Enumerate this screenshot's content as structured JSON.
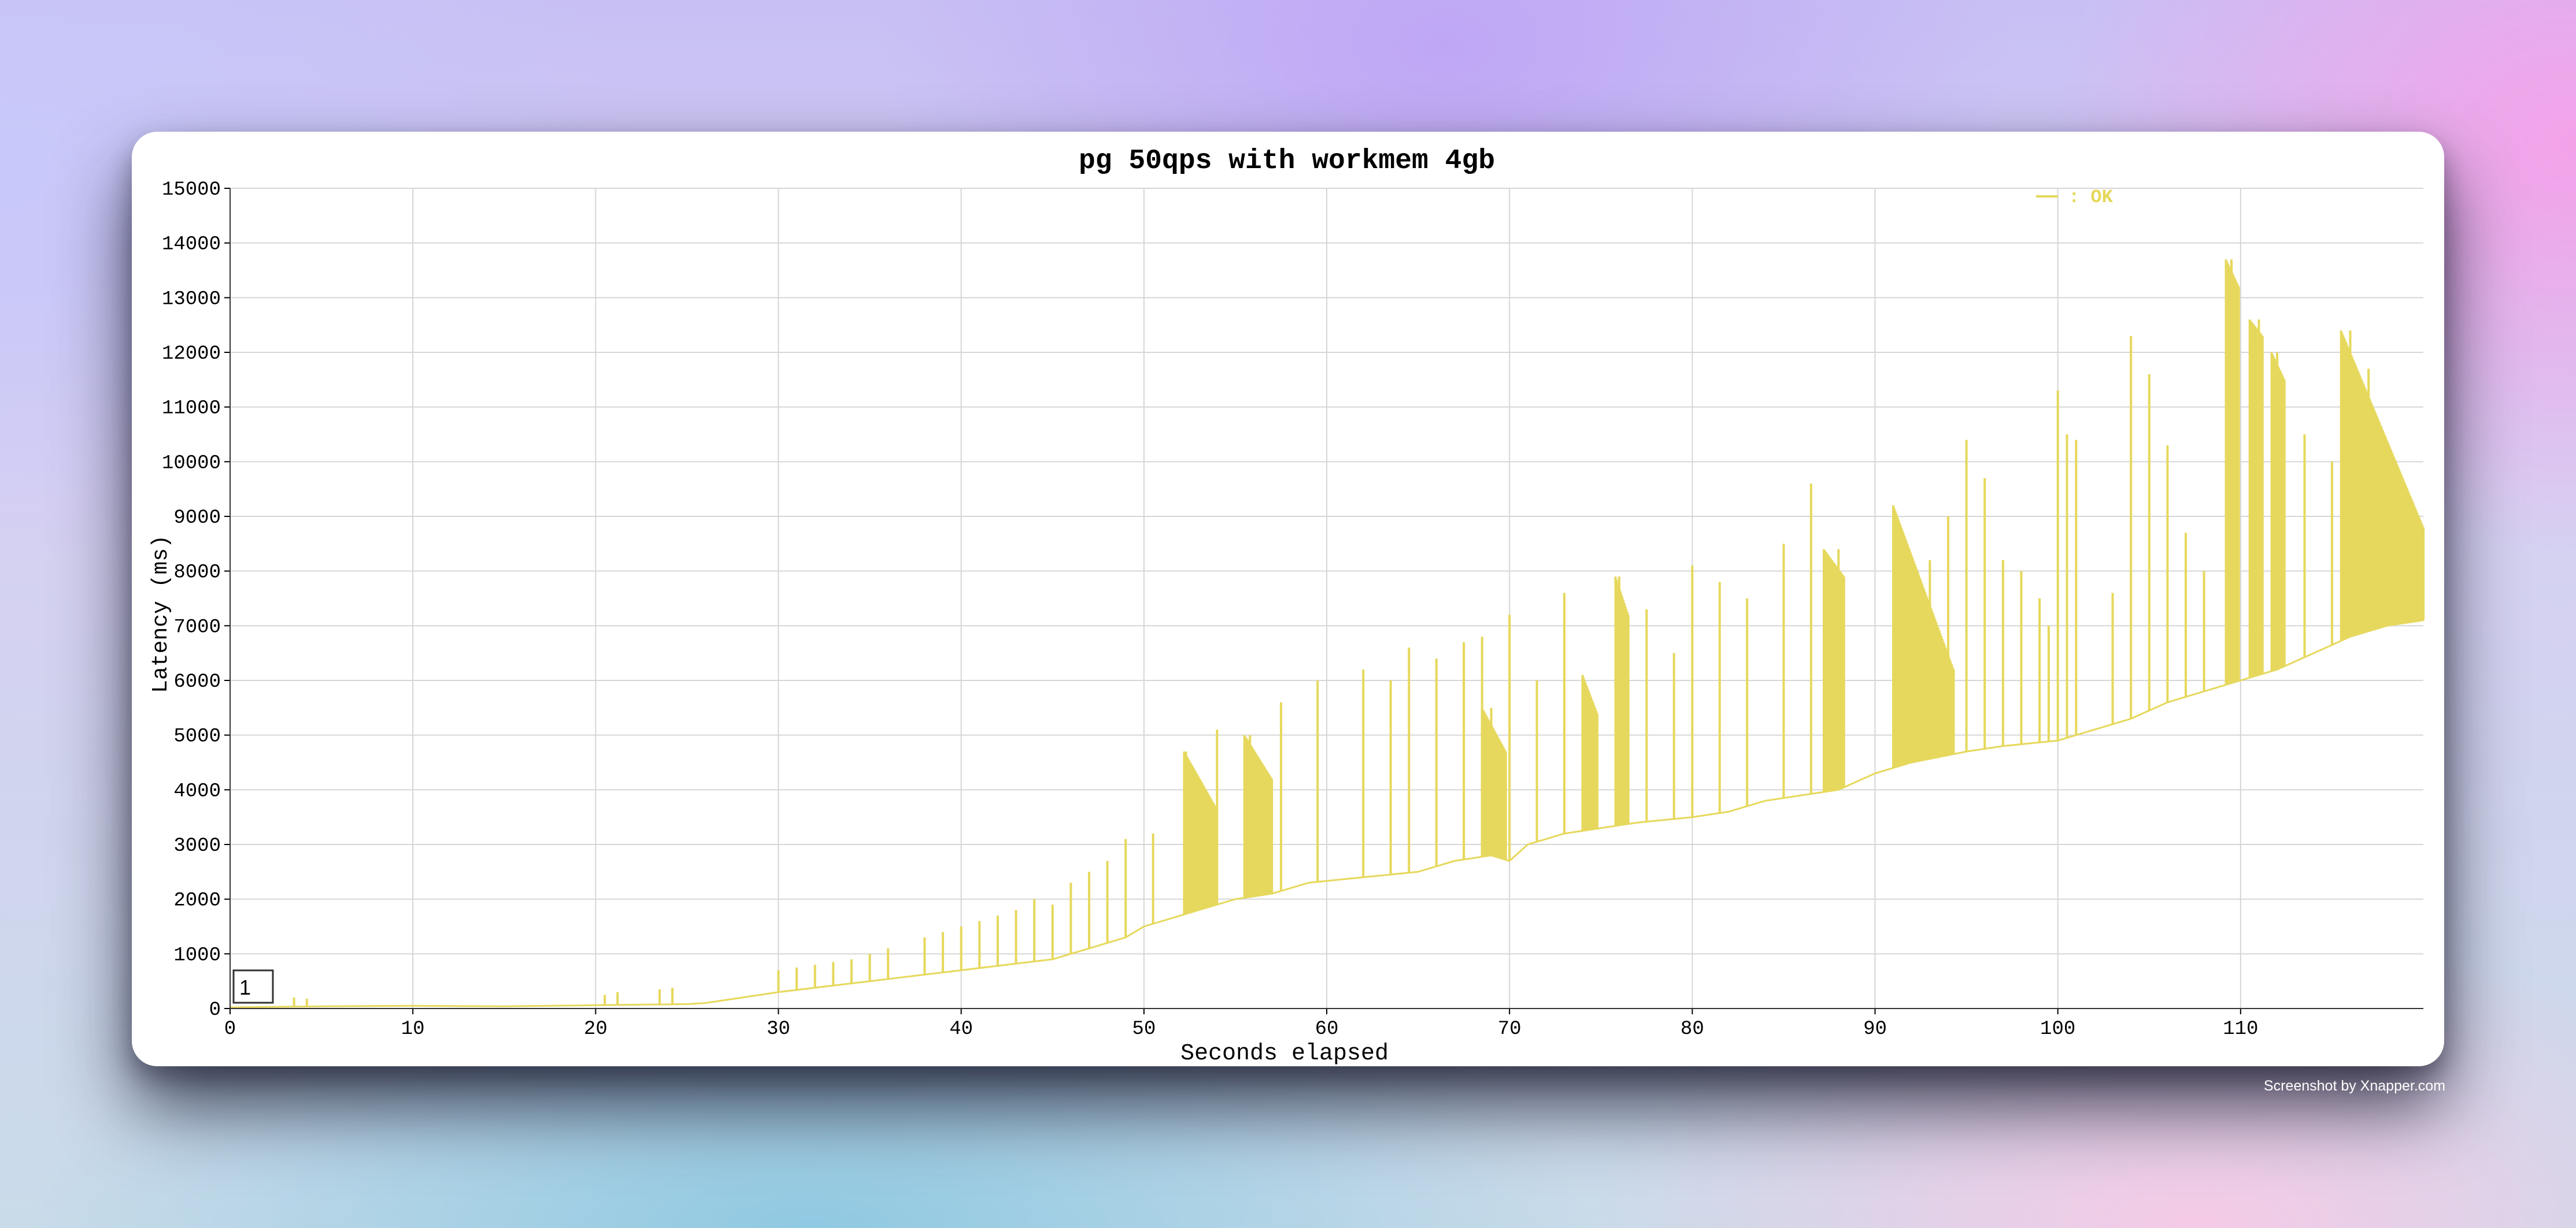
{
  "chart_data": {
    "type": "line",
    "title": "pg 50qps with workmem 4gb",
    "xlabel": "Seconds elapsed",
    "ylabel": "Latency (ms)",
    "xlim": [
      0,
      120
    ],
    "ylim": [
      0,
      15000
    ],
    "x_ticks": [
      0,
      10,
      20,
      30,
      40,
      50,
      60,
      70,
      80,
      90,
      100,
      110
    ],
    "y_ticks": [
      0,
      1000,
      2000,
      3000,
      4000,
      5000,
      6000,
      7000,
      8000,
      9000,
      10000,
      11000,
      12000,
      13000,
      14000,
      15000
    ],
    "grid": true,
    "legend_position": "top-right",
    "colors": {
      "series": "#e6d85c",
      "grid": "#d6d6d6",
      "text": "#000000"
    },
    "series": [
      {
        "name": ": OK",
        "baseline": [
          [
            0,
            20
          ],
          [
            5,
            40
          ],
          [
            10,
            50
          ],
          [
            15,
            40
          ],
          [
            20,
            60
          ],
          [
            25,
            80
          ],
          [
            26,
            100
          ],
          [
            28,
            200
          ],
          [
            30,
            300
          ],
          [
            35,
            500
          ],
          [
            40,
            700
          ],
          [
            45,
            900
          ],
          [
            47,
            1100
          ],
          [
            49,
            1300
          ],
          [
            50,
            1500
          ],
          [
            51,
            1600
          ],
          [
            53,
            1800
          ],
          [
            55,
            2000
          ],
          [
            57,
            2100
          ],
          [
            59,
            2300
          ],
          [
            62,
            2400
          ],
          [
            65,
            2500
          ],
          [
            67,
            2700
          ],
          [
            69,
            2800
          ],
          [
            70,
            2700
          ],
          [
            71,
            3000
          ],
          [
            73,
            3200
          ],
          [
            75,
            3300
          ],
          [
            77,
            3400
          ],
          [
            80,
            3500
          ],
          [
            82,
            3600
          ],
          [
            84,
            3800
          ],
          [
            86,
            3900
          ],
          [
            88,
            4000
          ],
          [
            90,
            4300
          ],
          [
            92,
            4500
          ],
          [
            95,
            4700
          ],
          [
            97,
            4800
          ],
          [
            100,
            4900
          ],
          [
            102,
            5100
          ],
          [
            104,
            5300
          ],
          [
            106,
            5600
          ],
          [
            108,
            5800
          ],
          [
            110,
            6000
          ],
          [
            112,
            6200
          ],
          [
            114,
            6500
          ],
          [
            116,
            6800
          ],
          [
            118,
            7000
          ],
          [
            120,
            7100
          ]
        ],
        "spikes": [
          [
            3.5,
            200
          ],
          [
            4.2,
            180
          ],
          [
            20.5,
            250
          ],
          [
            21.2,
            300
          ],
          [
            23.5,
            350
          ],
          [
            24.2,
            380
          ],
          [
            30,
            700
          ],
          [
            31,
            750
          ],
          [
            32,
            800
          ],
          [
            33,
            850
          ],
          [
            34,
            900
          ],
          [
            35,
            1000
          ],
          [
            36,
            1100
          ],
          [
            38,
            1300
          ],
          [
            39,
            1400
          ],
          [
            40,
            1500
          ],
          [
            41,
            1600
          ],
          [
            42,
            1700
          ],
          [
            43,
            1800
          ],
          [
            44,
            2000
          ],
          [
            45,
            1900
          ],
          [
            46,
            2300
          ],
          [
            47,
            2500
          ],
          [
            48,
            2700
          ],
          [
            49,
            3100
          ],
          [
            50.5,
            3200
          ],
          [
            52.3,
            4700
          ],
          [
            54,
            5100
          ],
          [
            55.8,
            5000
          ],
          [
            57.5,
            5600
          ],
          [
            59.5,
            6000
          ],
          [
            62,
            6200
          ],
          [
            63.5,
            6000
          ],
          [
            64.5,
            6600
          ],
          [
            66,
            6400
          ],
          [
            67.5,
            6700
          ],
          [
            68.5,
            6800
          ],
          [
            69,
            5500
          ],
          [
            70,
            7200
          ],
          [
            71.5,
            6000
          ],
          [
            73,
            7600
          ],
          [
            74,
            6100
          ],
          [
            76,
            7900
          ],
          [
            77.5,
            7300
          ],
          [
            79,
            6500
          ],
          [
            80,
            8100
          ],
          [
            81.5,
            7800
          ],
          [
            83,
            7500
          ],
          [
            85,
            8500
          ],
          [
            86.5,
            9600
          ],
          [
            88,
            8400
          ],
          [
            91,
            9200
          ],
          [
            93,
            8200
          ],
          [
            94,
            9000
          ],
          [
            95,
            10400
          ],
          [
            96,
            9700
          ],
          [
            97,
            8200
          ],
          [
            98,
            8000
          ],
          [
            99,
            7500
          ],
          [
            99.5,
            7000
          ],
          [
            100,
            11300
          ],
          [
            100.5,
            10500
          ],
          [
            101,
            10400
          ],
          [
            103,
            7600
          ],
          [
            104,
            12300
          ],
          [
            105,
            11600
          ],
          [
            106,
            10300
          ],
          [
            107,
            8700
          ],
          [
            108,
            8000
          ],
          [
            109.5,
            13700
          ],
          [
            111,
            12600
          ],
          [
            112,
            12000
          ],
          [
            113.5,
            10500
          ],
          [
            115,
            10000
          ],
          [
            116,
            12400
          ],
          [
            117,
            11700
          ],
          [
            118,
            9800
          ],
          [
            119,
            9300
          ],
          [
            120,
            8800
          ]
        ],
        "dense_segments": [
          [
            52.2,
            53.9,
            4700,
            3700
          ],
          [
            55.5,
            57,
            5000,
            4200
          ],
          [
            68.5,
            69.8,
            5500,
            4700
          ],
          [
            74,
            74.8,
            6100,
            5400
          ],
          [
            75.8,
            76.5,
            7900,
            7200
          ],
          [
            87.2,
            88.3,
            8400,
            7900
          ],
          [
            91,
            94.3,
            9200,
            6200
          ],
          [
            109.2,
            109.9,
            13700,
            13200
          ],
          [
            110.5,
            111.2,
            12600,
            12300
          ],
          [
            111.7,
            112.4,
            12000,
            11500
          ],
          [
            115.5,
            120,
            12400,
            8800
          ]
        ]
      }
    ]
  },
  "watermark": "Screenshot by Xnapper.com",
  "axis_widget_value": "1"
}
